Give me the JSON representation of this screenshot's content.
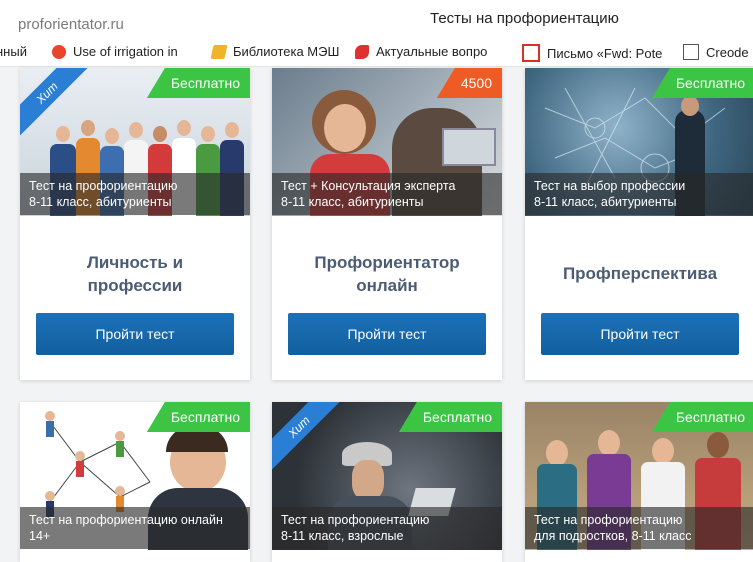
{
  "browser": {
    "site": "proforientator.ru",
    "page_title": "Тесты на профориентацию",
    "bookmarks": [
      {
        "label": "нный",
        "icon": "none"
      },
      {
        "label": "Use of irrigation in",
        "icon": "irrigation-icon"
      },
      {
        "label": "Библиотека МЭШ",
        "icon": "library-icon"
      },
      {
        "label": "Актуальные вопро",
        "icon": "leaf-icon"
      },
      {
        "label": "Письмо «Fwd: Pote",
        "icon": "mail-icon"
      },
      {
        "label": "Creode",
        "icon": "document-icon"
      }
    ]
  },
  "cards": [
    {
      "badge": "Бесплатно",
      "ribbon": "Хит",
      "caption": [
        "Тест на профориентацию",
        "8-11 класс, абитуриенты"
      ],
      "title": [
        "Личность и",
        "профессии"
      ],
      "button": "Пройти тест"
    },
    {
      "badge": "4500",
      "ribbon": "",
      "caption": [
        "Тест + Консультация эксперта",
        "8-11 класс, абитуриенты"
      ],
      "title": [
        "Профориентатор",
        "онлайн"
      ],
      "button": "Пройти тест"
    },
    {
      "badge": "Бесплатно",
      "ribbon": "",
      "caption": [
        "Тест на выбор профессии",
        "8-11 класс, абитуриенты"
      ],
      "title": [
        "Профперспектива"
      ],
      "button": "Пройти тест"
    },
    {
      "badge": "Бесплатно",
      "ribbon": "",
      "caption": [
        "Тест на профориентацию онлайн",
        "14+"
      ]
    },
    {
      "badge": "Бесплатно",
      "ribbon": "Хит",
      "caption": [
        "Тест на профориентацию",
        "8-11 класс, взрослые"
      ]
    },
    {
      "badge": "Бесплатно",
      "ribbon": "",
      "caption": [
        "Тест на профориентацию",
        "для подростков, 8-11 класс"
      ]
    }
  ],
  "colors": {
    "free_badge": "#3cc444",
    "paid_badge": "#ef5b25",
    "ribbon": "#2a7fd4",
    "button": "#1d71b8",
    "title_text": "#4b5d74"
  }
}
